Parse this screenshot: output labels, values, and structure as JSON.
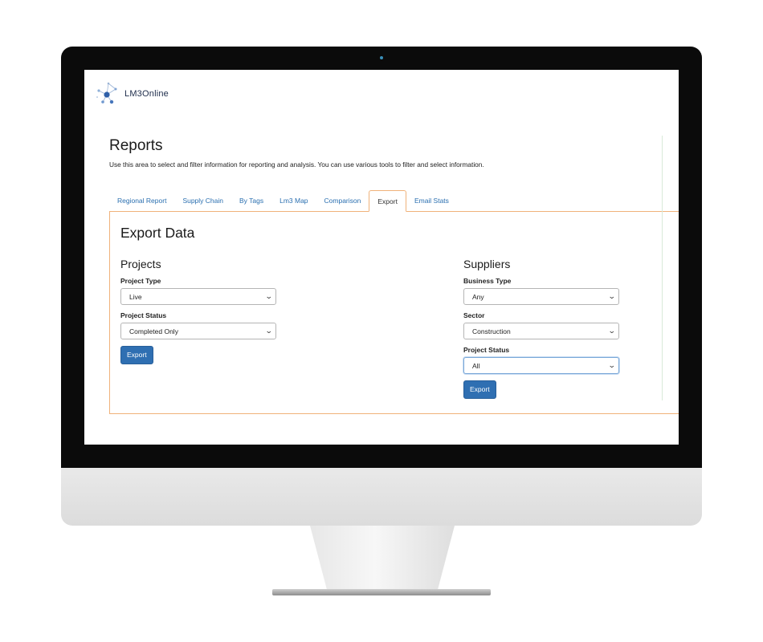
{
  "brand": {
    "name": "LM3Online"
  },
  "page": {
    "title": "Reports",
    "description": "Use this area to select and filter information for reporting and analysis.  You can use various tools to filter and select information."
  },
  "tabs": [
    {
      "label": "Regional Report",
      "active": false
    },
    {
      "label": "Supply Chain",
      "active": false
    },
    {
      "label": "By Tags",
      "active": false
    },
    {
      "label": "Lm3 Map",
      "active": false
    },
    {
      "label": "Comparison",
      "active": false
    },
    {
      "label": "Export",
      "active": true
    },
    {
      "label": "Email Stats",
      "active": false
    }
  ],
  "export": {
    "title": "Export Data",
    "projects": {
      "heading": "Projects",
      "project_type": {
        "label": "Project Type",
        "value": "Live"
      },
      "project_status": {
        "label": "Project Status",
        "value": "Completed Only"
      },
      "export_label": "Export"
    },
    "suppliers": {
      "heading": "Suppliers",
      "business_type": {
        "label": "Business Type",
        "value": "Any"
      },
      "sector": {
        "label": "Sector",
        "value": "Construction"
      },
      "project_status": {
        "label": "Project Status",
        "value": "All"
      },
      "export_label": "Export"
    }
  },
  "colors": {
    "accent_border": "#f0b27a",
    "link": "#2a6fb0",
    "button": "#2f6fb2"
  },
  "icons": {
    "select_arrow": "chevron-down-icon",
    "logo": "network-nodes-icon"
  }
}
